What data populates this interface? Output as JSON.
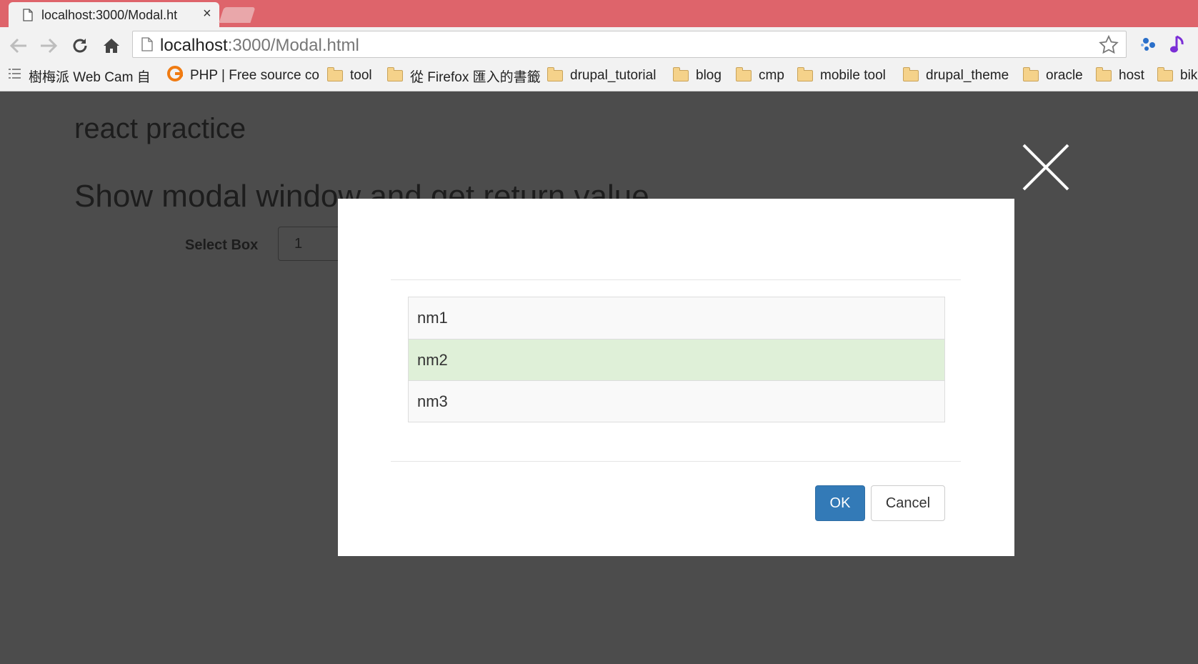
{
  "browser": {
    "tab": {
      "title": "localhost:3000/Modal.ht",
      "close": "×"
    },
    "address": {
      "host": "localhost",
      "rest": ":3000/Modal.html"
    },
    "bookmarks": [
      {
        "label": "樹梅派 Web Cam 自",
        "icon": "apps-icon"
      },
      {
        "label": "PHP | Free source co",
        "icon": "php-icon"
      },
      {
        "label": "tool",
        "icon": "folder-icon"
      },
      {
        "label": "從 Firefox 匯入的書籤",
        "icon": "folder-icon"
      },
      {
        "label": "drupal_tutorial",
        "icon": "folder-icon"
      },
      {
        "label": "blog",
        "icon": "folder-icon"
      },
      {
        "label": "cmp",
        "icon": "folder-icon"
      },
      {
        "label": "mobile tool",
        "icon": "folder-icon"
      },
      {
        "label": "drupal_theme",
        "icon": "folder-icon"
      },
      {
        "label": "oracle",
        "icon": "folder-icon"
      },
      {
        "label": "host",
        "icon": "folder-icon"
      },
      {
        "label": "bik",
        "icon": "folder-icon"
      }
    ]
  },
  "page": {
    "title": "react practice",
    "subtitle": "Show modal window and get return value",
    "select_label": "Select Box",
    "select_value": "1"
  },
  "modal": {
    "items": [
      {
        "label": "nm1",
        "selected": false
      },
      {
        "label": "nm2",
        "selected": true
      },
      {
        "label": "nm3",
        "selected": false
      }
    ],
    "ok_label": "OK",
    "cancel_label": "Cancel"
  },
  "colors": {
    "tabstrip": "#de646b",
    "overlay": "#4c4c4c",
    "selected_row": "#dff0d8",
    "primary": "#337ab7"
  }
}
